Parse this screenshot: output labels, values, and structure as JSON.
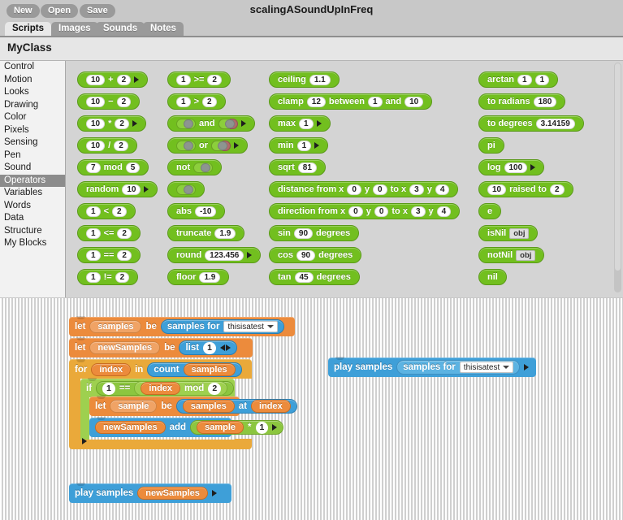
{
  "window": {
    "project_title": "scalingASoundUpInFreq"
  },
  "toolbar": {
    "buttons": [
      "New",
      "Open",
      "Save"
    ]
  },
  "tabs": {
    "items": [
      "Scripts",
      "Images",
      "Sounds",
      "Notes"
    ],
    "active": "Scripts"
  },
  "class_header": {
    "name": "MyClass"
  },
  "categories": {
    "items": [
      "Control",
      "Motion",
      "Looks",
      "Drawing",
      "Color",
      "Pixels",
      "Sensing",
      "Pen",
      "Sound",
      "Operators",
      "Variables",
      "Words",
      "Data",
      "Structure",
      "My Blocks"
    ],
    "selected": "Operators"
  },
  "palette": {
    "column1": [
      {
        "parts": [
          "10",
          "+",
          "2"
        ],
        "arrow": true,
        "name": "operator-add"
      },
      {
        "parts": [
          "10",
          "−",
          "2"
        ],
        "arrow": false,
        "name": "operator-subtract"
      },
      {
        "parts": [
          "10",
          "*",
          "2"
        ],
        "arrow": true,
        "name": "operator-multiply"
      },
      {
        "parts": [
          "10",
          "/",
          "2"
        ],
        "arrow": false,
        "name": "operator-divide"
      },
      {
        "parts": [
          "7",
          "mod",
          "5"
        ],
        "arrow": false,
        "name": "operator-mod"
      },
      {
        "parts": [
          "random",
          "10"
        ],
        "arrow": true,
        "name": "operator-random"
      },
      {
        "parts": [
          "1",
          "<",
          "2"
        ],
        "arrow": false,
        "name": "operator-lt"
      },
      {
        "parts": [
          "1",
          "<=",
          "2"
        ],
        "arrow": false,
        "name": "operator-lte"
      },
      {
        "parts": [
          "1",
          "==",
          "2"
        ],
        "arrow": false,
        "name": "operator-eq"
      },
      {
        "parts": [
          "1",
          "!=",
          "2"
        ],
        "arrow": false,
        "name": "operator-neq"
      }
    ],
    "column2": [
      {
        "label": "1 >= 2",
        "name": "operator-gte"
      },
      {
        "label": "1 > 2",
        "name": "operator-gt"
      },
      {
        "label": "and",
        "name": "operator-and"
      },
      {
        "label": "or",
        "name": "operator-or"
      },
      {
        "label": "not",
        "name": "operator-not"
      },
      {
        "label": "",
        "name": "operator-boolean"
      },
      {
        "label": "abs -10",
        "name": "operator-abs"
      },
      {
        "label": "truncate 1.9",
        "name": "operator-truncate"
      },
      {
        "label": "round 123.456",
        "name": "operator-round"
      },
      {
        "label": "floor 1.9",
        "name": "operator-floor"
      }
    ],
    "column2_values": {
      "gte_a": "1",
      "gte_op": ">=",
      "gte_b": "2",
      "gt_a": "1",
      "gt_op": ">",
      "gt_b": "2",
      "and_label": "and",
      "or_label": "or",
      "not_label": "not",
      "abs_label": "abs",
      "abs_value": "-10",
      "truncate_label": "truncate",
      "truncate_value": "1.9",
      "round_label": "round",
      "round_value": "123.456",
      "floor_label": "floor",
      "floor_value": "1.9"
    },
    "column3": {
      "ceiling_label": "ceiling",
      "ceiling_value": "1.1",
      "clamp_label": "clamp",
      "clamp_value": "12",
      "clamp_between": "between",
      "clamp_min": "1",
      "clamp_and": "and",
      "clamp_max": "10",
      "max_label": "max",
      "max_value": "1",
      "min_label": "min",
      "min_value": "1",
      "sqrt_label": "sqrt",
      "sqrt_value": "81",
      "distance_label": "distance from x",
      "distance_x1": "0",
      "distance_y_lbl": "y",
      "distance_y1": "0",
      "distance_to": "to x",
      "distance_x2": "3",
      "distance_y_lbl2": "y",
      "distance_y2": "4",
      "direction_label": "direction from x",
      "direction_x1": "0",
      "direction_y_lbl": "y",
      "direction_y1": "0",
      "direction_to": "to x",
      "direction_x2": "3",
      "direction_y_lbl2": "y",
      "direction_y2": "4",
      "sin_label": "sin",
      "sin_value": "90",
      "sin_unit": "degrees",
      "cos_label": "cos",
      "cos_value": "90",
      "cos_unit": "degrees",
      "tan_label": "tan",
      "tan_value": "45",
      "tan_unit": "degrees"
    },
    "column4": {
      "arctan_label": "arctan",
      "arctan_a": "1",
      "arctan_b": "1",
      "toradians_label": "to radians",
      "toradians_value": "180",
      "todegrees_label": "to degrees",
      "todegrees_value": "3.14159",
      "pi_label": "pi",
      "log_label": "log",
      "log_value": "100",
      "raised_base": "10",
      "raised_label": "raised to",
      "raised_exp": "2",
      "e_label": "e",
      "isnil_label": "isNil",
      "isnil_slot": "obj",
      "notnil_label": "notNil",
      "notnil_slot": "obj",
      "nil_label": "nil"
    }
  },
  "script": {
    "let_samples": {
      "let": "let",
      "var": "samples",
      "be": "be",
      "reporter": "samples for",
      "dropdown": "thisisatest"
    },
    "let_newsamples": {
      "let": "let",
      "var": "newSamples",
      "be": "be",
      "reporter": "list",
      "value": "1"
    },
    "for_loop": {
      "for": "for",
      "var": "index",
      "in": "in",
      "count": "count",
      "countvar": "samples"
    },
    "if_block": {
      "if": "if",
      "left": "1",
      "op": "==",
      "var": "index",
      "mod": "mod",
      "right": "2"
    },
    "let_sample": {
      "let": "let",
      "var": "sample",
      "be": "be",
      "list": "samples",
      "at": "at",
      "index": "index"
    },
    "add_block": {
      "listvar": "newSamples",
      "add": "add",
      "var": "sample",
      "op": "*",
      "value": "1"
    },
    "play_newsamples": {
      "label": "play samples",
      "var": "newSamples"
    },
    "play_detached": {
      "label": "play samples",
      "reporter": "samples for",
      "dropdown": "thisisatest"
    }
  }
}
